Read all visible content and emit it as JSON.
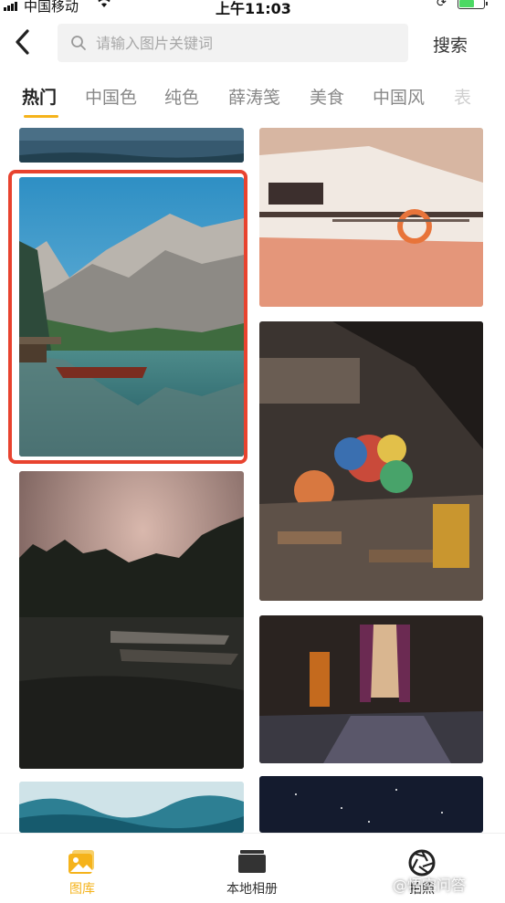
{
  "status_bar": {
    "carrier": "中国移动",
    "time": "上午11:03"
  },
  "header": {
    "search_placeholder": "请输入图片关键词",
    "search_button": "搜索"
  },
  "tabs": [
    {
      "label": "热门",
      "active": true
    },
    {
      "label": "中国色",
      "active": false
    },
    {
      "label": "纯色",
      "active": false
    },
    {
      "label": "薛涛笺",
      "active": false
    },
    {
      "label": "美食",
      "active": false
    },
    {
      "label": "中国风",
      "active": false
    },
    {
      "label": "表",
      "active": false
    }
  ],
  "colors": {
    "accent": "#f5b31b",
    "highlight": "#e8432f"
  },
  "gallery": {
    "left_column": [
      "lake-shore-partial",
      "mountain-lake-boat",
      "cloudy-lake-dusk",
      "ocean-wave-partial"
    ],
    "right_column": [
      "white-boat-deck",
      "floating-market",
      "dark-room-window",
      "starry-sky-partial"
    ],
    "selected": "mountain-lake-boat"
  },
  "bottom_nav": [
    {
      "label": "图库",
      "icon": "gallery-icon",
      "active": true
    },
    {
      "label": "本地相册",
      "icon": "folder-icon",
      "active": false
    },
    {
      "label": "拍照",
      "icon": "camera-shutter-icon",
      "active": false
    }
  ],
  "watermark": "@悟空问答"
}
